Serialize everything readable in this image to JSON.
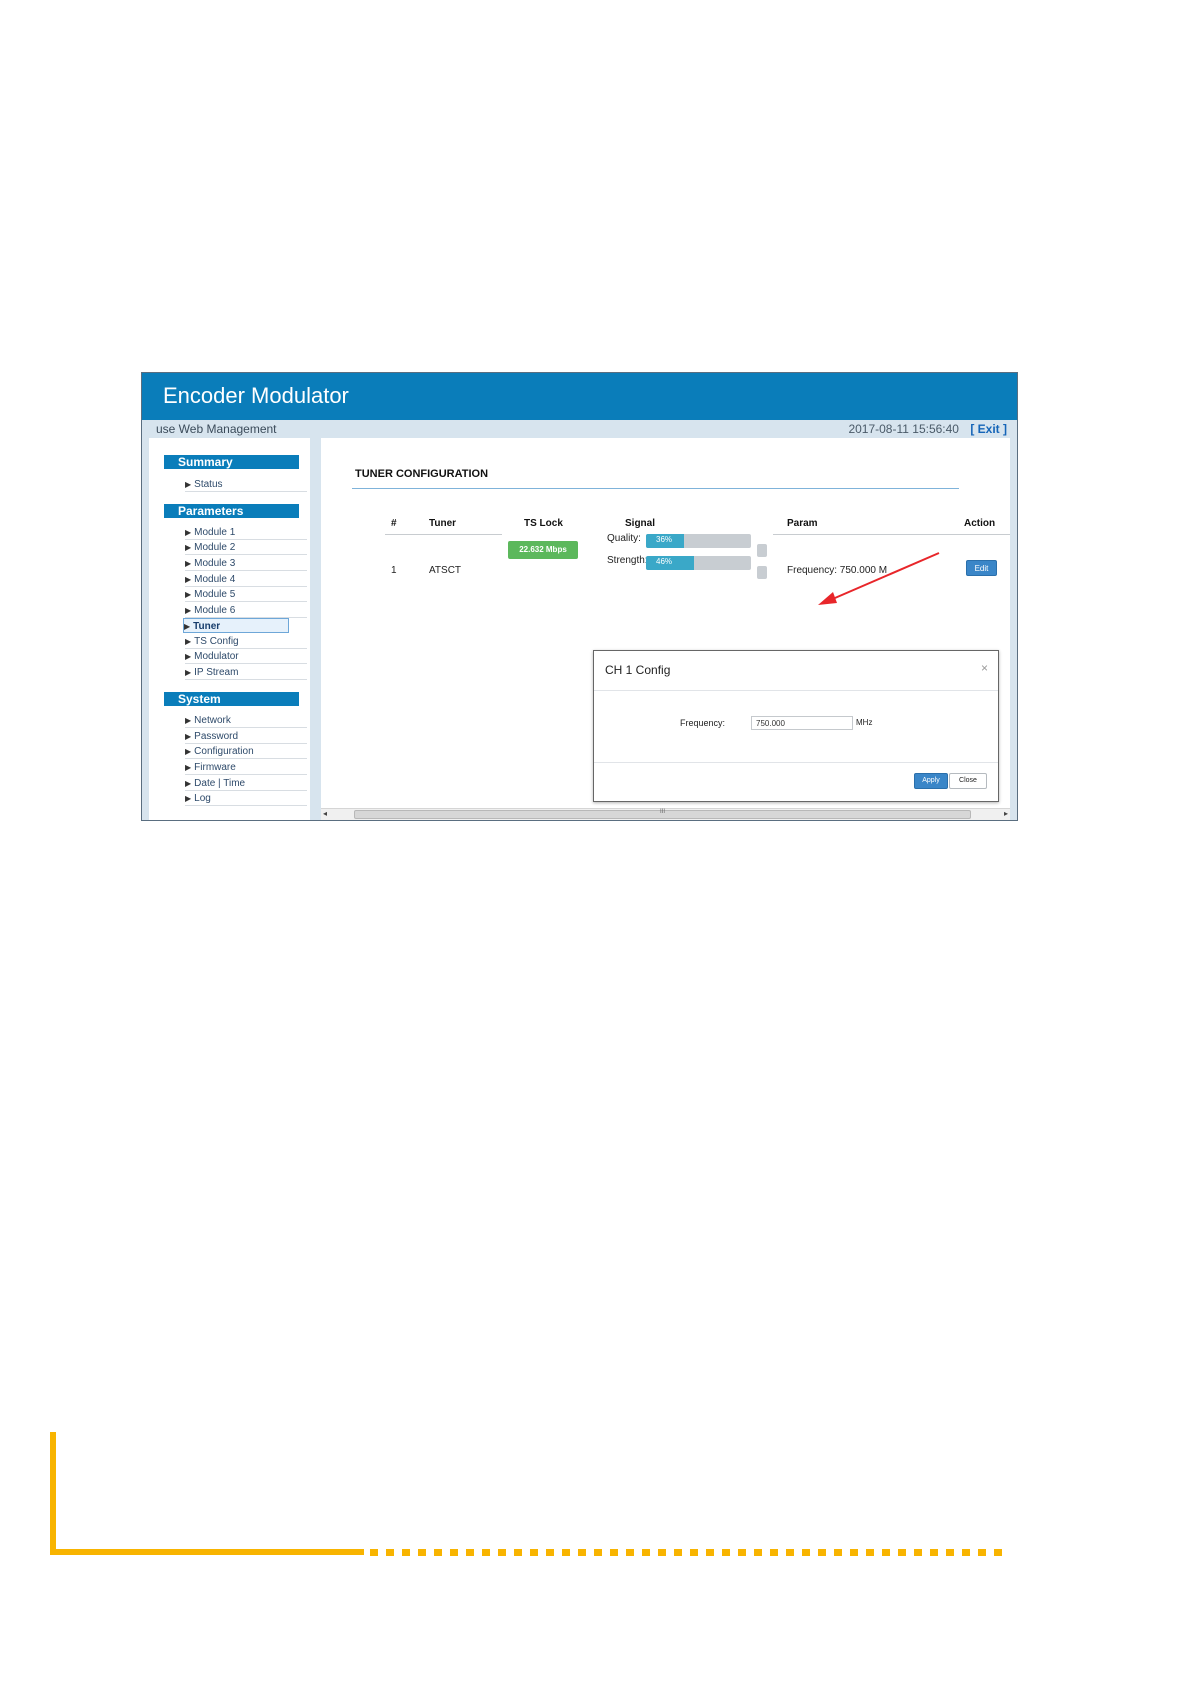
{
  "header": {
    "title": "Encoder Modulator"
  },
  "subbar": {
    "left_text": "use Web Management",
    "datetime": "2017-08-11 15:56:40",
    "exit_label": "[ Exit ]"
  },
  "sidebar": {
    "sections": [
      {
        "title": "Summary",
        "items": [
          "Status"
        ]
      },
      {
        "title": "Parameters",
        "items": [
          "Module 1",
          "Module 2",
          "Module 3",
          "Module 4",
          "Module 5",
          "Module 6",
          "Tuner",
          "TS Config",
          "Modulator",
          "IP Stream"
        ]
      },
      {
        "title": "System",
        "items": [
          "Network",
          "Password",
          "Configuration",
          "Firmware",
          "Date | Time",
          "Log"
        ]
      }
    ],
    "active_item": "Tuner"
  },
  "main": {
    "page_title": "TUNER CONFIGURATION",
    "columns": [
      "#",
      "Tuner",
      "TS Lock",
      "Signal",
      "Param",
      "Action"
    ],
    "row": {
      "index": "1",
      "tuner": "ATSCT",
      "ts_lock": "22.632 Mbps",
      "quality_label": "Quality:",
      "quality_value": "36%",
      "quality_percent": 36,
      "strength_label": "Strength:",
      "strength_value": "46%",
      "strength_percent": 46,
      "param": "Frequency: 750.000 M",
      "action_label": "Edit"
    }
  },
  "modal": {
    "title": "CH 1 Config",
    "close_icon": "×",
    "frequency_label": "Frequency:",
    "frequency_value": "750.000",
    "frequency_unit": "MHz",
    "apply_label": "Apply",
    "close_label": "Close"
  },
  "scrollbar": {
    "left_arrow": "◂",
    "right_arrow": "▸",
    "grip": "III"
  },
  "colors": {
    "header_blue": "#0a7dba",
    "accent_yellow": "#f8b400",
    "arrow_red": "#e8262a",
    "ts_lock_green": "#5cb85c"
  }
}
